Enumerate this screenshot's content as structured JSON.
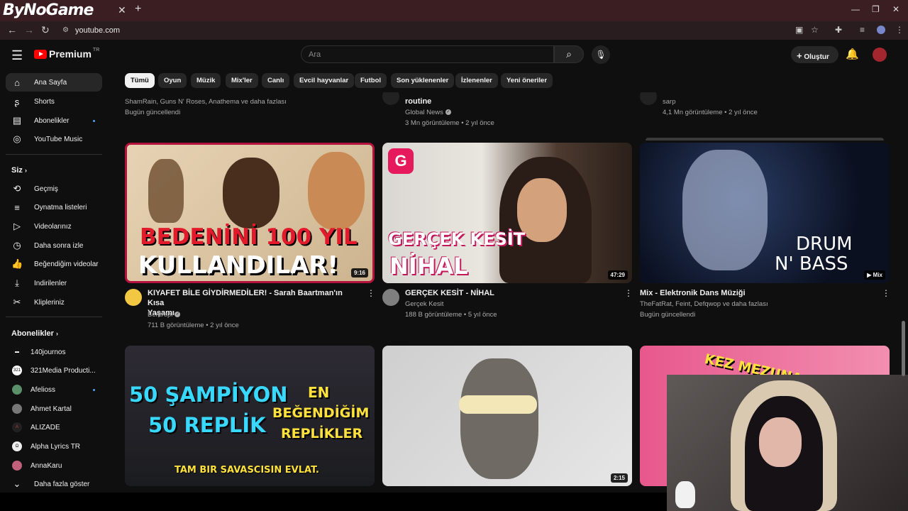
{
  "browser": {
    "logo": "ByNoGame",
    "url": "youtube.com",
    "tab_close": "✕",
    "tab_new": "+"
  },
  "youtube": {
    "brand": "Premium",
    "brand_sup": "TR",
    "search_placeholder": "Ara",
    "create_label": "Oluştur"
  },
  "sidebar": {
    "main": [
      {
        "label": "Ana Sayfa",
        "icon": "home-icon"
      },
      {
        "label": "Shorts",
        "icon": "shorts-icon"
      },
      {
        "label": "Abonelikler",
        "icon": "subscriptions-icon"
      },
      {
        "label": "YouTube Music",
        "icon": "music-icon"
      }
    ],
    "you_heading": "Siz",
    "you": [
      {
        "label": "Geçmiş",
        "icon": "history-icon"
      },
      {
        "label": "Oynatma listeleri",
        "icon": "playlist-icon"
      },
      {
        "label": "Videolarınız",
        "icon": "your-videos-icon"
      },
      {
        "label": "Daha sonra izle",
        "icon": "watch-later-icon"
      },
      {
        "label": "Beğendiğim videolar",
        "icon": "liked-icon"
      },
      {
        "label": "İndirilenler",
        "icon": "download-icon"
      },
      {
        "label": "Klipleriniz",
        "icon": "clips-icon"
      }
    ],
    "subs_heading": "Abonelikler",
    "subs": [
      {
        "label": "140journos",
        "color": "#111111"
      },
      {
        "label": "321Media Producti...",
        "color": "#ffffff"
      },
      {
        "label": "Afelioss",
        "color": "#5b8f6a"
      },
      {
        "label": "Ahmet Kartal",
        "color": "#777777"
      },
      {
        "label": "ALIZADE",
        "color": "#222222"
      },
      {
        "label": "Alpha Lyrics TR",
        "color": "#eeeeee"
      },
      {
        "label": "AnnaKaru",
        "color": "#c0607a"
      }
    ],
    "show_more": "Daha fazla göster"
  },
  "chips": [
    "Tümü",
    "Oyun",
    "Müzik",
    "Mix'ler",
    "Canlı",
    "Evcil hayvanlar",
    "Futbol",
    "Son yüklenenler",
    "İzlenenler",
    "Yeni öneriler"
  ],
  "partial_row": {
    "col1_line1": "ShamRain, Guns N' Roses, Anathema ve daha fazlası",
    "col1_line2": "Bugün güncellendi",
    "col2_title": "routine",
    "col2_channel": "Global News",
    "col2_meta": "3 Mn görüntüleme • 2 yıl önce",
    "col3_channel": "sarp",
    "col3_meta": "4,1 Mn görüntüleme • 2 yıl önce"
  },
  "videos": [
    {
      "title_line1": "KIYAFET BİLE GİYDİRMEDİLER! - Sarah Baartman'ın Kısa",
      "title_line2": "Yaşamı",
      "channel": "Bentropi",
      "meta": "711 B görüntüleme • 2 yıl önce",
      "duration": "9:16",
      "overlay1": "BEDENİNİ 100 YIL",
      "overlay2": "KULLANDILAR!"
    },
    {
      "title_line1": "GERÇEK KESİT - NİHAL",
      "channel": "Gerçek Kesit",
      "meta": "188 B görüntüleme • 5 yıl önce",
      "duration": "47:29",
      "overlay1": "GERÇEK KESİT",
      "overlay2": "NİHAL"
    },
    {
      "title_line1": "Mix - Elektronik Dans Müziği",
      "channel": "TheFatRat, Feint, Defqwop ve daha fazlası",
      "meta": "Bugün güncellendi",
      "duration": "Mix",
      "overlay1": "DRUM",
      "overlay2": "N' BASS"
    },
    {
      "overlay1": "50 ŞAMPİYON",
      "overlay2": "50 REPLİK",
      "overlay3": "EN",
      "overlay4": "BEĞENDİĞİM",
      "overlay5": "REPLİKLER",
      "overlay6": "TAM BIR SAVASCISIN EVLAT."
    },
    {
      "duration": "2:15"
    },
    {
      "overlay1": "KEZ MEZUNA"
    }
  ]
}
